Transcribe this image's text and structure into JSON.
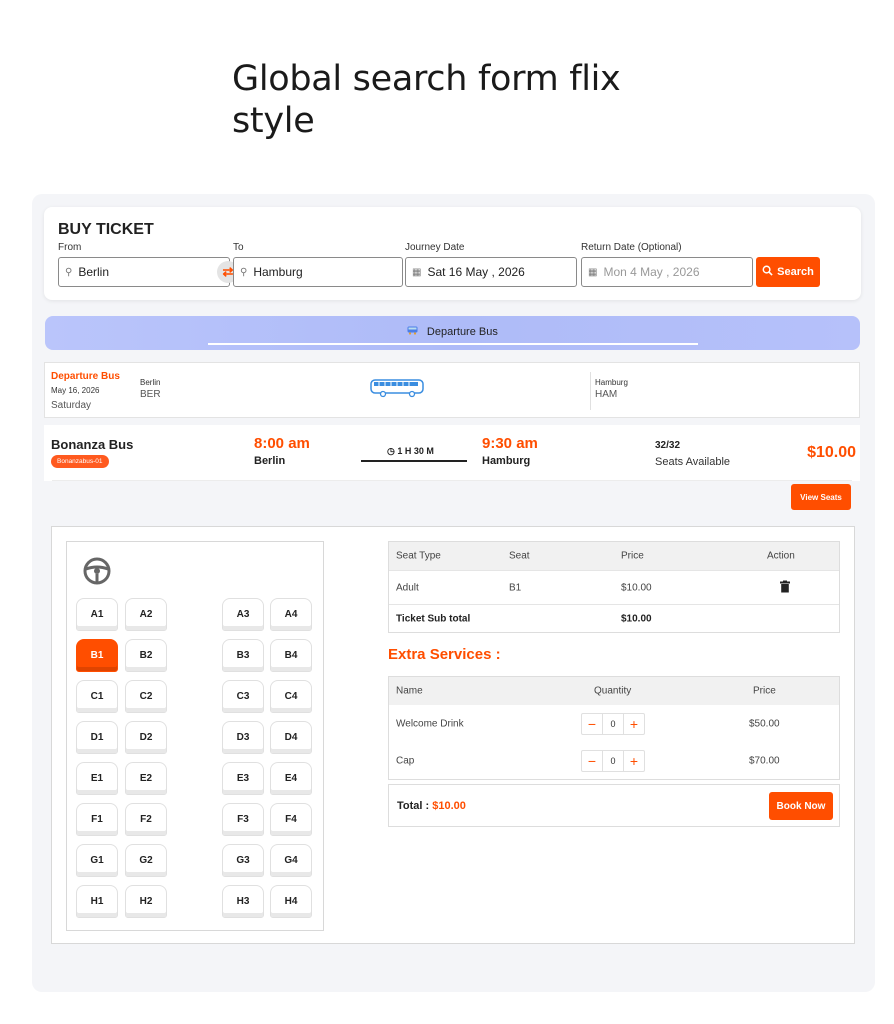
{
  "page": {
    "heading": "Global search form flix style"
  },
  "search": {
    "title": "BUY TICKET",
    "from_label": "From",
    "from_value": "Berlin",
    "to_label": "To",
    "to_value": "Hamburg",
    "journey_label": "Journey Date",
    "journey_value": "Sat 16 May , 2026",
    "return_label": "Return Date (Optional)",
    "return_placeholder": "Mon 4 May , 2026",
    "search_button": "Search",
    "swap_icon": "⇄"
  },
  "tab": {
    "label": "Departure Bus",
    "icon": "bus-icon"
  },
  "route": {
    "title": "Departure Bus",
    "date": "May 16, 2026",
    "weekday": "Saturday",
    "from_city": "Berlin",
    "from_code": "BER",
    "to_city": "Hamburg",
    "to_code": "HAM"
  },
  "bus": {
    "name": "Bonanza Bus",
    "code": "Bonanzabus-01",
    "departure_time": "8:00 am",
    "departure_city": "Berlin",
    "duration": "1 H 30 M",
    "arrival_time": "9:30 am",
    "arrival_city": "Hamburg",
    "seats_count": "32/32",
    "seats_label": "Seats Available",
    "price": "$10.00",
    "view_seats": "View Seats"
  },
  "seats": {
    "rows": [
      [
        "A1",
        "A2",
        "A3",
        "A4"
      ],
      [
        "B1",
        "B2",
        "B3",
        "B4"
      ],
      [
        "C1",
        "C2",
        "C3",
        "C4"
      ],
      [
        "D1",
        "D2",
        "D3",
        "D4"
      ],
      [
        "E1",
        "E2",
        "E3",
        "E4"
      ],
      [
        "F1",
        "F2",
        "F3",
        "F4"
      ],
      [
        "G1",
        "G2",
        "G3",
        "G4"
      ],
      [
        "H1",
        "H2",
        "H3",
        "H4"
      ]
    ],
    "selected": [
      "B1"
    ]
  },
  "summary": {
    "headers": [
      "Seat Type",
      "Seat",
      "Price",
      "Action"
    ],
    "rows": [
      {
        "type": "Adult",
        "seat": "B1",
        "price": "$10.00"
      }
    ],
    "subtotal_label": "Ticket Sub total",
    "subtotal_value": "$10.00"
  },
  "extras": {
    "title": "Extra Services :",
    "headers": [
      "Name",
      "Quantity",
      "Price"
    ],
    "items": [
      {
        "name": "Welcome Drink",
        "qty": "0",
        "price": "$50.00"
      },
      {
        "name": "Cap",
        "qty": "0",
        "price": "$70.00"
      }
    ]
  },
  "total": {
    "label": "Total :",
    "value": "$10.00",
    "book_now": "Book Now"
  },
  "colors": {
    "accent": "#ff4e00",
    "tab_gradient": "#b6c1fa"
  }
}
